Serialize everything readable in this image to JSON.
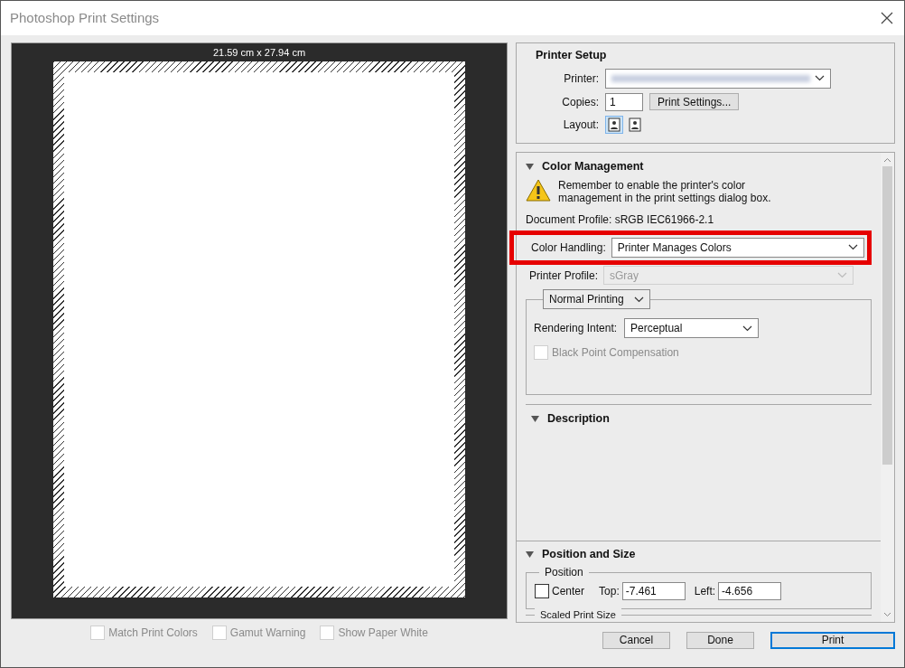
{
  "window": {
    "title": "Photoshop Print Settings"
  },
  "preview": {
    "size_label": "21.59 cm x 27.94 cm"
  },
  "preview_options": [
    {
      "label": "Match Print Colors",
      "checked": false,
      "disabled": true
    },
    {
      "label": "Gamut Warning",
      "checked": false,
      "disabled": true
    },
    {
      "label": "Show Paper White",
      "checked": false,
      "disabled": true
    }
  ],
  "printer_setup": {
    "title": "Printer Setup",
    "printer_label": "Printer:",
    "copies_label": "Copies:",
    "copies_value": "1",
    "print_settings_button": "Print Settings...",
    "layout_label": "Layout:",
    "layouts": [
      {
        "selected": true
      },
      {
        "selected": false
      }
    ]
  },
  "color_management": {
    "title": "Color Management",
    "expanded": true,
    "warning": "Remember to enable the printer's color management in the print settings dialog box.",
    "document_profile": "Document Profile: sRGB IEC61966-2.1",
    "color_handling": {
      "label": "Color Handling:",
      "value": "Printer Manages Colors",
      "highlighted": true
    },
    "printer_profile": {
      "label": "Printer Profile:",
      "value": "sGray",
      "disabled": true
    },
    "print_mode": "Normal Printing",
    "rendering_intent": {
      "label": "Rendering Intent:",
      "value": "Perceptual"
    },
    "black_point": {
      "label": "Black Point Compensation",
      "checked": false,
      "disabled": true
    }
  },
  "description": {
    "title": "Description",
    "expanded": true
  },
  "position_and_size": {
    "title": "Position and Size",
    "expanded": true,
    "position_group": "Position",
    "center": {
      "label": "Center",
      "checked": false
    },
    "top": {
      "label": "Top:",
      "value": "-7.461"
    },
    "left": {
      "label": "Left:",
      "value": "-4.656"
    },
    "scaled_print_size": "Scaled Print Size"
  },
  "buttons": [
    {
      "label": "Cancel",
      "kind": "normal"
    },
    {
      "label": "Done",
      "kind": "normal"
    },
    {
      "label": "Print",
      "kind": "default"
    }
  ]
}
